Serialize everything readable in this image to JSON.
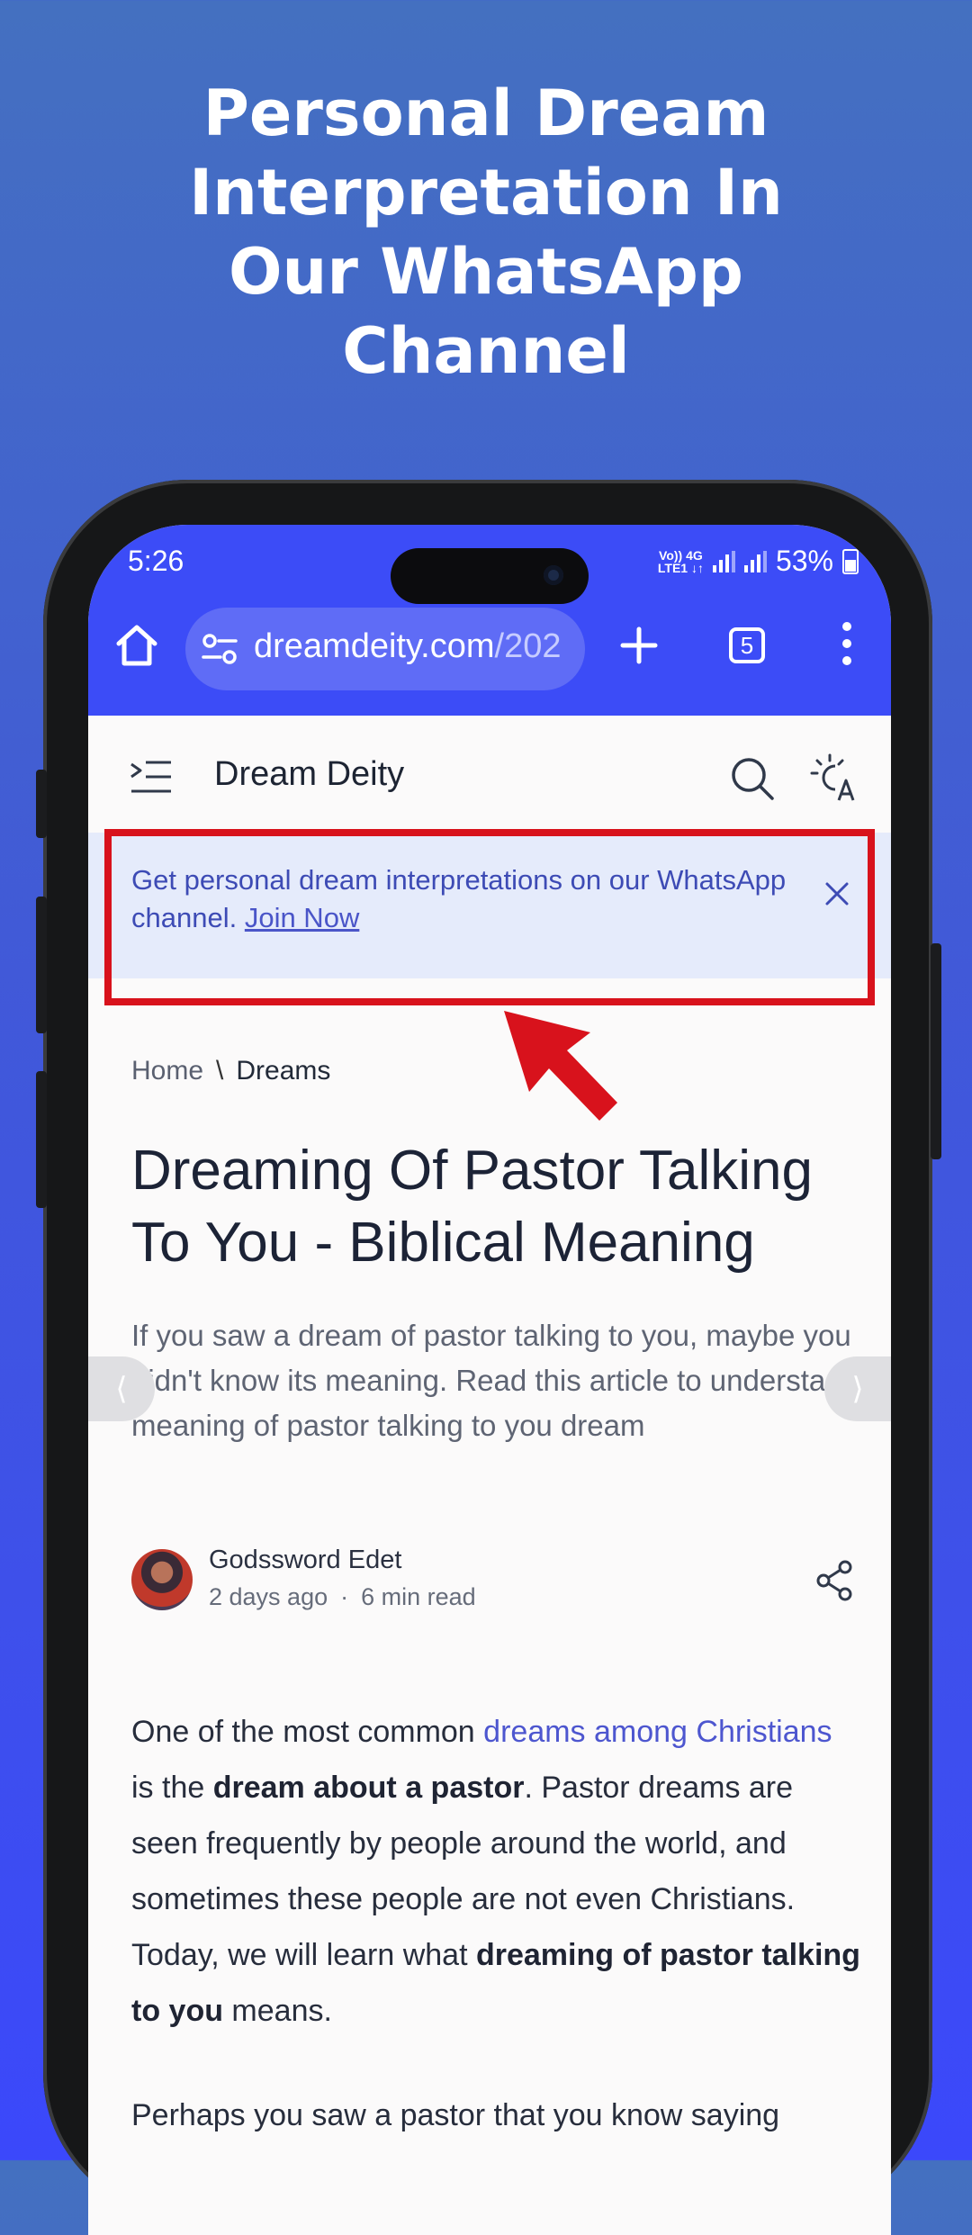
{
  "promo": {
    "headline_line1": "Personal Dream",
    "headline_line2": "Interpretation In",
    "headline_line3": "Our WhatsApp",
    "headline_line4": "Channel"
  },
  "status_bar": {
    "time": "5:26",
    "network_top": "Vo)) 4G",
    "network_bottom": "LTE1 ↓↑",
    "battery": "53%"
  },
  "browser": {
    "url_host": "dreamdeity.com",
    "url_path": "/202",
    "tab_count": "5"
  },
  "site": {
    "name": "Dream Deity"
  },
  "banner": {
    "text": "Get personal dream interpretations on our WhatsApp channel. ",
    "link": "Join Now"
  },
  "breadcrumb": {
    "home": "Home",
    "separator": "\\",
    "current": "Dreams"
  },
  "article": {
    "title": "Dreaming Of Pastor Talking To You - Biblical Meaning",
    "excerpt": "If you saw a dream of pastor talking to you, maybe you didn't know its meaning. Read this article to understand meaning of pastor talking to you dream",
    "author": "Godssword Edet",
    "posted": "2 days ago",
    "meta_separator": "·",
    "read_time": "6 min read",
    "p1_a": "One of the most common ",
    "p1_link": "dreams among Christians",
    "p1_b": " is the ",
    "p1_bold1": "dream about a pastor",
    "p1_c": ". Pastor dreams are seen frequently by people around the world, and sometimes these people are not even Christians. Today, we will learn what ",
    "p1_bold2": "dreaming of pastor talking to you",
    "p1_d": " means.",
    "p2": "Perhaps you saw a pastor that you know saying"
  },
  "nav": {
    "prev": "⟨",
    "next": "⟩"
  },
  "colors": {
    "browser_bar": "#3c4cf7",
    "highlight": "#d8121c",
    "banner_bg": "#e5ebfb",
    "link": "#4d56cf"
  }
}
